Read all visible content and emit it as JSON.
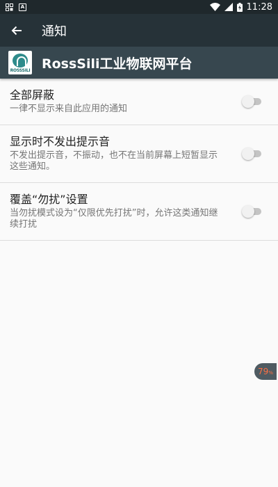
{
  "status_bar": {
    "left_icons": [
      "notification-icon",
      "text-icon"
    ],
    "time": "11:28",
    "right_icons": [
      "wifi-icon",
      "signal-icon",
      "battery-charging-icon"
    ]
  },
  "app_bar": {
    "title": "通知"
  },
  "app_header": {
    "name": "RossSili工业物联网平台",
    "logo_text": "ROSSSILI"
  },
  "settings": [
    {
      "title": "全部屏蔽",
      "summary": "一律不显示来自此应用的通知",
      "enabled": false
    },
    {
      "title": "显示时不发出提示音",
      "summary": "不发出提示音，不振动，也不在当前屏幕上短暂显示这些通知。",
      "enabled": false
    },
    {
      "title": "覆盖“勿扰”设置",
      "summary": "当勿扰模式设为“仅限优先打扰”时，允许这类通知继续打扰",
      "enabled": false
    }
  ],
  "floating_badge": {
    "value": "79",
    "unit": "%"
  },
  "colors": {
    "status_bar": "#1f282c",
    "app_bar": "#263238",
    "app_header": "#37474f",
    "background": "#fafafa",
    "badge_text": "#ff7043"
  }
}
